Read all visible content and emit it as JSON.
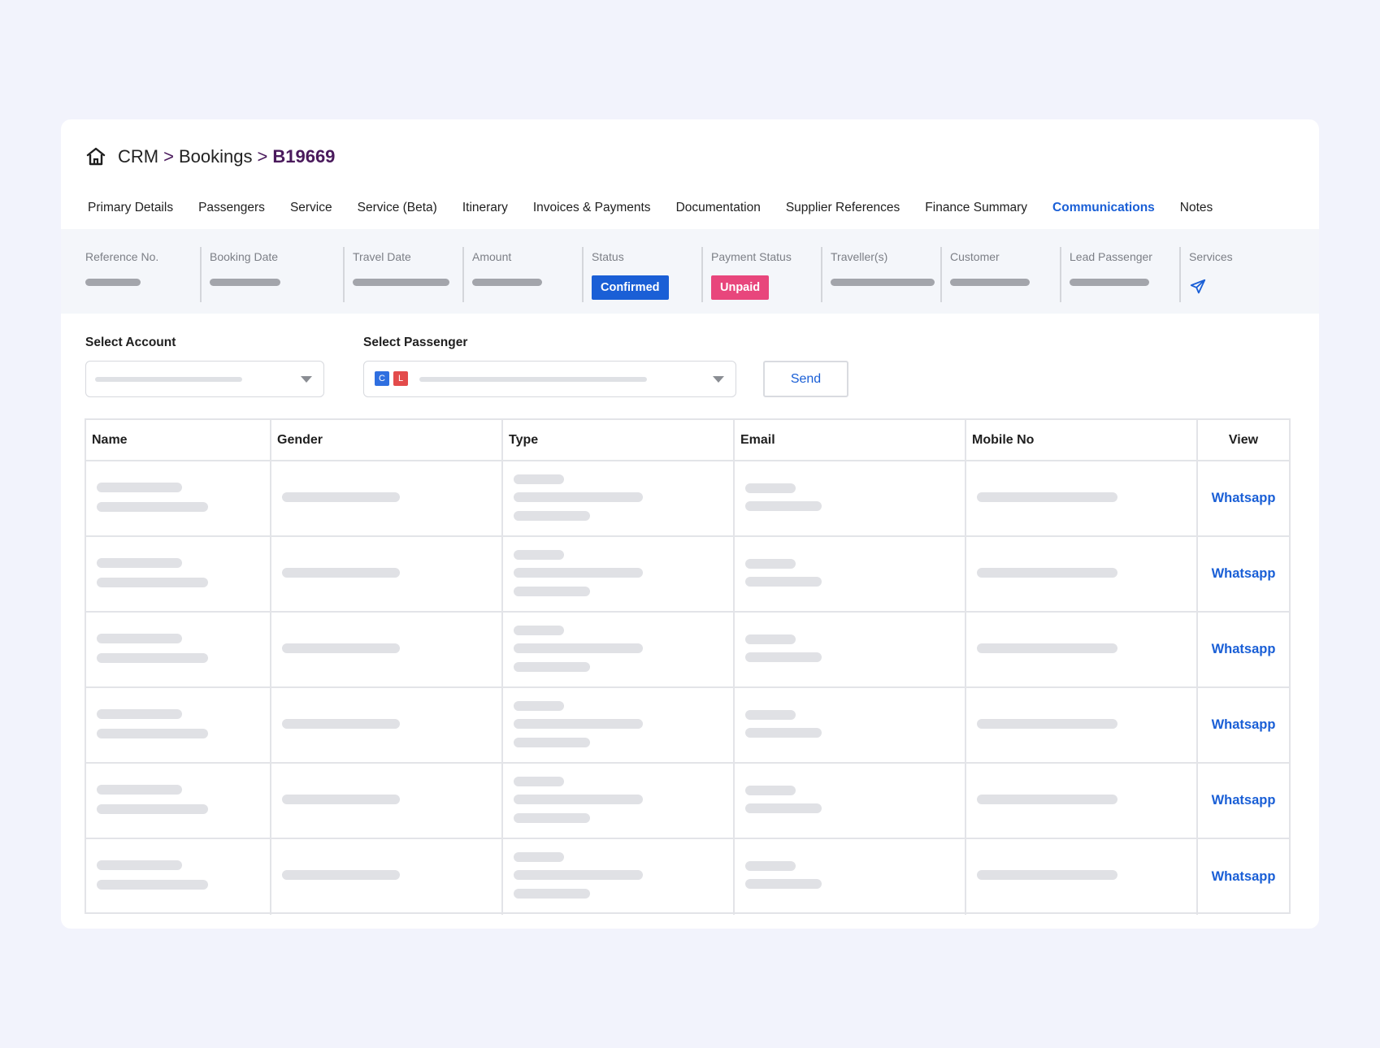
{
  "breadcrumb": {
    "items": [
      "CRM",
      "Bookings"
    ],
    "current": "B19669",
    "separator": ">"
  },
  "tabs": [
    {
      "label": "Primary Details",
      "active": false
    },
    {
      "label": "Passengers",
      "active": false
    },
    {
      "label": "Service",
      "active": false
    },
    {
      "label": "Service (Beta)",
      "active": false
    },
    {
      "label": "Itinerary",
      "active": false
    },
    {
      "label": "Invoices & Payments",
      "active": false
    },
    {
      "label": "Documentation",
      "active": false
    },
    {
      "label": "Supplier References",
      "active": false
    },
    {
      "label": "Finance Summary",
      "active": false
    },
    {
      "label": "Communications",
      "active": true
    },
    {
      "label": "Notes",
      "active": false
    }
  ],
  "summary": {
    "reference_no": "Reference No.",
    "booking_date": "Booking Date",
    "travel_date": "Travel Date",
    "amount": "Amount",
    "status": "Status",
    "status_value": "Confirmed",
    "payment_status": "Payment Status",
    "payment_status_value": "Unpaid",
    "travellers": "Traveller(s)",
    "customer": "Customer",
    "lead_passenger": "Lead Passenger",
    "services": "Services",
    "services_icon": "plane-icon"
  },
  "colors": {
    "accent": "#1a5fd6",
    "confirmed": "#1a5fd6",
    "unpaid": "#e8467c",
    "chip_c": "#2f6fe0",
    "chip_l": "#e34b4b",
    "title": "#4a1a5c"
  },
  "form": {
    "select_account_label": "Select Account",
    "select_passenger_label": "Select Passenger",
    "passenger_chips": [
      "C",
      "L"
    ],
    "send_label": "Send"
  },
  "table": {
    "headers": [
      "Name",
      "Gender",
      "Type",
      "Email",
      "Mobile No",
      "View"
    ],
    "rows": [
      {
        "view": "Whatsapp"
      },
      {
        "view": "Whatsapp"
      },
      {
        "view": "Whatsapp"
      },
      {
        "view": "Whatsapp"
      },
      {
        "view": "Whatsapp"
      },
      {
        "view": "Whatsapp"
      }
    ]
  }
}
